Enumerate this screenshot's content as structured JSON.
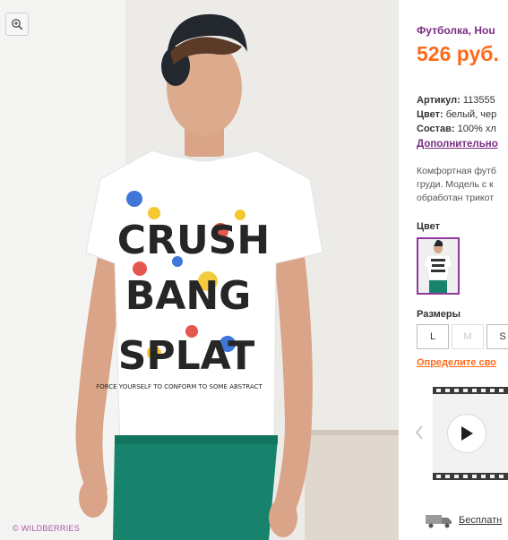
{
  "product": {
    "title": "Футболка, Hou",
    "price": "526 руб.",
    "watermark": "© WILDBERRIES",
    "tshirt_print_lines": [
      "CRUSH",
      "BANG",
      "SPLAT",
      "FORCE YOURSELF TO CONFORM TO SOME ABSTRACT"
    ]
  },
  "attributes": [
    {
      "label": "Артикул:",
      "value": "113555"
    },
    {
      "label": "Цвет:",
      "value": "белый, чер"
    },
    {
      "label": "Состав:",
      "value": "100% хл"
    }
  ],
  "more_link": "Дополнительно",
  "description": [
    "Комфортная футб",
    "груди. Модель с к",
    "обработан трикот"
  ],
  "color_section": {
    "label": "Цвет"
  },
  "sizes_section": {
    "label": "Размеры",
    "sizes": [
      {
        "label": "L",
        "available": true
      },
      {
        "label": "M",
        "available": false
      },
      {
        "label": "S",
        "available": true
      }
    ]
  },
  "size_help_link": "Определите сво",
  "delivery": {
    "label": "Бесплатн"
  },
  "colors": {
    "accent_purple": "#7b2d83",
    "price_orange": "#ff6a1a"
  },
  "icons": [
    "zoom-in-icon",
    "chevron-left-icon",
    "play-icon",
    "truck-icon"
  ]
}
